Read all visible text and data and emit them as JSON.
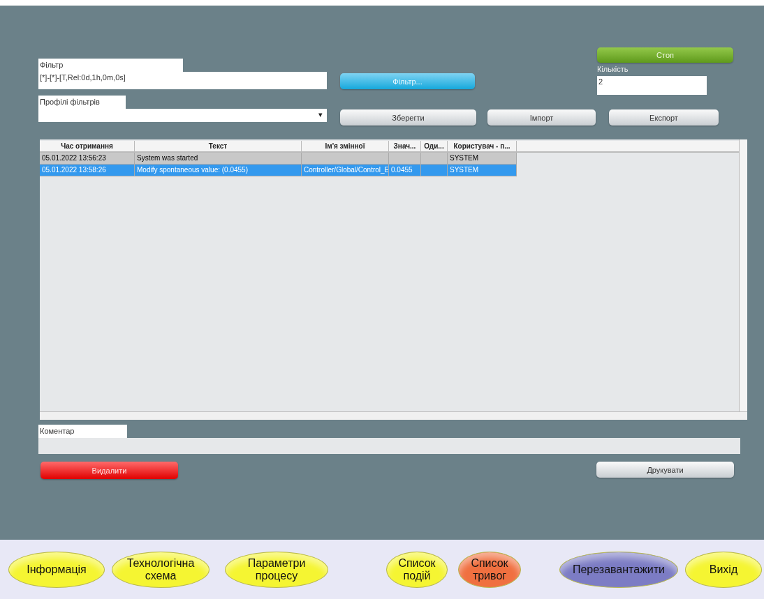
{
  "filter": {
    "label": "Фільтр",
    "value": "[*]-[*]-[T,Rel:0d,1h,0m,0s]",
    "button": "Фільтр..."
  },
  "profiles": {
    "label": "Профілі фільтрів",
    "arrow": "▾"
  },
  "stop_button": "Стоп",
  "count": {
    "label": "Кількість",
    "value": "2"
  },
  "actions": [
    "Зберегти",
    "Імпорт",
    "Експорт"
  ],
  "table": {
    "columns": [
      "Час отримання",
      "Текст",
      "Ім'я змінної",
      "Знач...",
      "Оди...",
      "Користувач - п..."
    ],
    "rows": [
      {
        "selected": false,
        "cells": [
          "05.01.2022 13:56:23",
          "System was started",
          "",
          "",
          "",
          "SYSTEM"
        ]
      },
      {
        "selected": true,
        "cells": [
          "05.01.2022 13:58:26",
          "Modify spontaneous value: (0.0455)",
          "Controller/Global/Control_E",
          "0.0455",
          "",
          "SYSTEM"
        ]
      }
    ]
  },
  "comment": {
    "label": "Коментар"
  },
  "delete_button": "Видалити",
  "print_button": "Друкувати",
  "nav": [
    {
      "label": "Інформація",
      "color": "#f5f532"
    },
    {
      "label": "Технологічна схема",
      "color": "#f5f532"
    },
    {
      "label": "Параметри процесу",
      "color": "#f5f532"
    },
    {
      "label": "Список подій",
      "color": "#f5f532"
    },
    {
      "label": "Список тривог",
      "color": "#f07040"
    },
    {
      "label": "Перезавантажити",
      "color": "#7c7cc4"
    },
    {
      "label": "Вихід",
      "color": "#f5f532"
    }
  ]
}
